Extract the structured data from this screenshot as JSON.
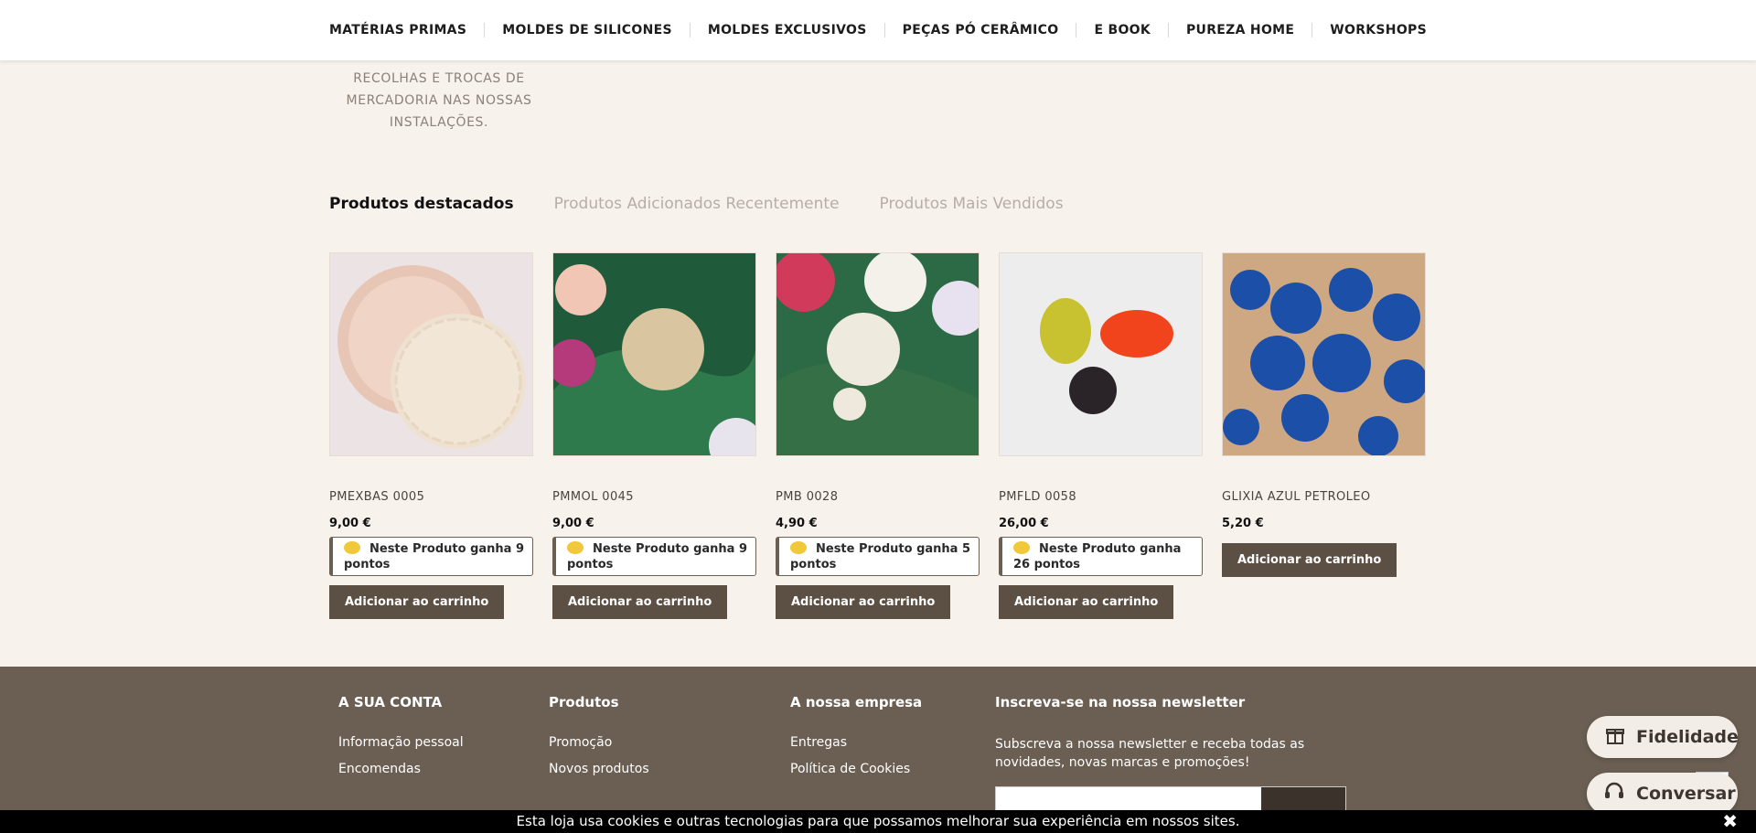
{
  "nav": {
    "items": [
      "MATÉRIAS PRIMAS",
      "MOLDES DE SILICONES",
      "MOLDES EXCLUSIVOS",
      "PEÇAS PÓ CERÂMICO",
      "E BOOK",
      "PUREZA HOME",
      "WORKSHOPS"
    ]
  },
  "info": {
    "lines": [
      "RECOLHAS E TROCAS DE",
      "MERCADORIA NAS NOSSAS",
      "INSTALAÇÕES."
    ]
  },
  "tabs": [
    "Produtos destacados",
    "Produtos Adicionados Recentemente",
    "Produtos Mais Vendidos"
  ],
  "products": [
    {
      "name": "PMEXBAS 0005",
      "price": "9,00 €",
      "points": "Neste Produto ganha 9 pontos",
      "cart": "Adicionar ao carrinho"
    },
    {
      "name": "PMMOL 0045",
      "price": "9,00 €",
      "points": "Neste Produto ganha 9 pontos",
      "cart": "Adicionar ao carrinho"
    },
    {
      "name": "PMB 0028",
      "price": "4,90 €",
      "points": "Neste Produto ganha 5 pontos",
      "cart": "Adicionar ao carrinho"
    },
    {
      "name": "PMFLD 0058",
      "price": "26,00 €",
      "points": "Neste Produto ganha 26 pontos",
      "cart": "Adicionar ao carrinho"
    },
    {
      "name": "GLIXIA AZUL PETROLEO",
      "price": "5,20 €",
      "cart": "Adicionar ao carrinho"
    }
  ],
  "footer": {
    "account": {
      "title": "A SUA CONTA",
      "links": [
        "Informação pessoal",
        "Encomendas"
      ]
    },
    "products": {
      "title": "Produtos",
      "links": [
        "Promoção",
        "Novos produtos"
      ]
    },
    "company": {
      "title": "A nossa empresa",
      "links": [
        "Entregas",
        "Política de Cookies"
      ]
    },
    "newsletter": {
      "title": "Inscreva-se na nossa newsletter",
      "text": "Subscreva a nossa newsletter e receba todas as novidades, novas marcas e promoções!"
    }
  },
  "floating": {
    "fidelidade": "Fidelidade",
    "conversar": "Conversar"
  },
  "cookie": {
    "text": "Esta loja usa cookies e outras tecnologias para que possamos melhorar sua experiência em nossos sites.",
    "close": "✖"
  },
  "colors": {
    "accent": "#5c4f43",
    "footer_bg": "#6b5f53",
    "page_bg": "#f8f2ec",
    "coin": "#f1c83a"
  }
}
